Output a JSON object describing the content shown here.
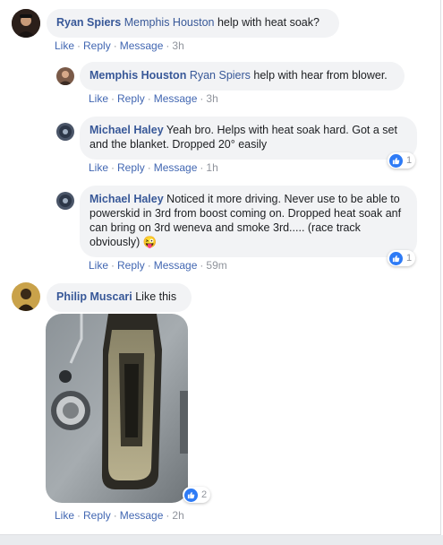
{
  "actions": {
    "like": "Like",
    "reply": "Reply",
    "message": "Message"
  },
  "comments": [
    {
      "author": "Ryan Spiers",
      "tag": "Memphis Houston",
      "text": " help with heat soak?",
      "time": "3h"
    },
    {
      "author": "Memphis Houston",
      "tag": "Ryan Spiers",
      "text": " help with hear from blower.",
      "time": "3h"
    },
    {
      "author": "Michael Haley",
      "text": " Yeah bro. Helps with heat soak hard. Got a set and the blanket. Dropped 20° easily",
      "time": "1h",
      "reactions": "1"
    },
    {
      "author": "Michael Haley",
      "text": " Noticed it more driving. Never use to be able to powerskid in 3rd from boost coming on. Dropped heat soak anf can bring on 3rd weneva and smoke 3rd..... (race track obviously) ",
      "emoji": "😜",
      "time": "59m",
      "reactions": "1"
    },
    {
      "author": "Philip Muscari",
      "text": " Like this",
      "time": "2h",
      "reactions": "2"
    }
  ],
  "colors": {
    "link": "#385898",
    "action": "#4267b2",
    "bubble": "#f2f3f5",
    "like": "#2e7bf6"
  },
  "icons": {
    "reaction": "like-icon"
  }
}
